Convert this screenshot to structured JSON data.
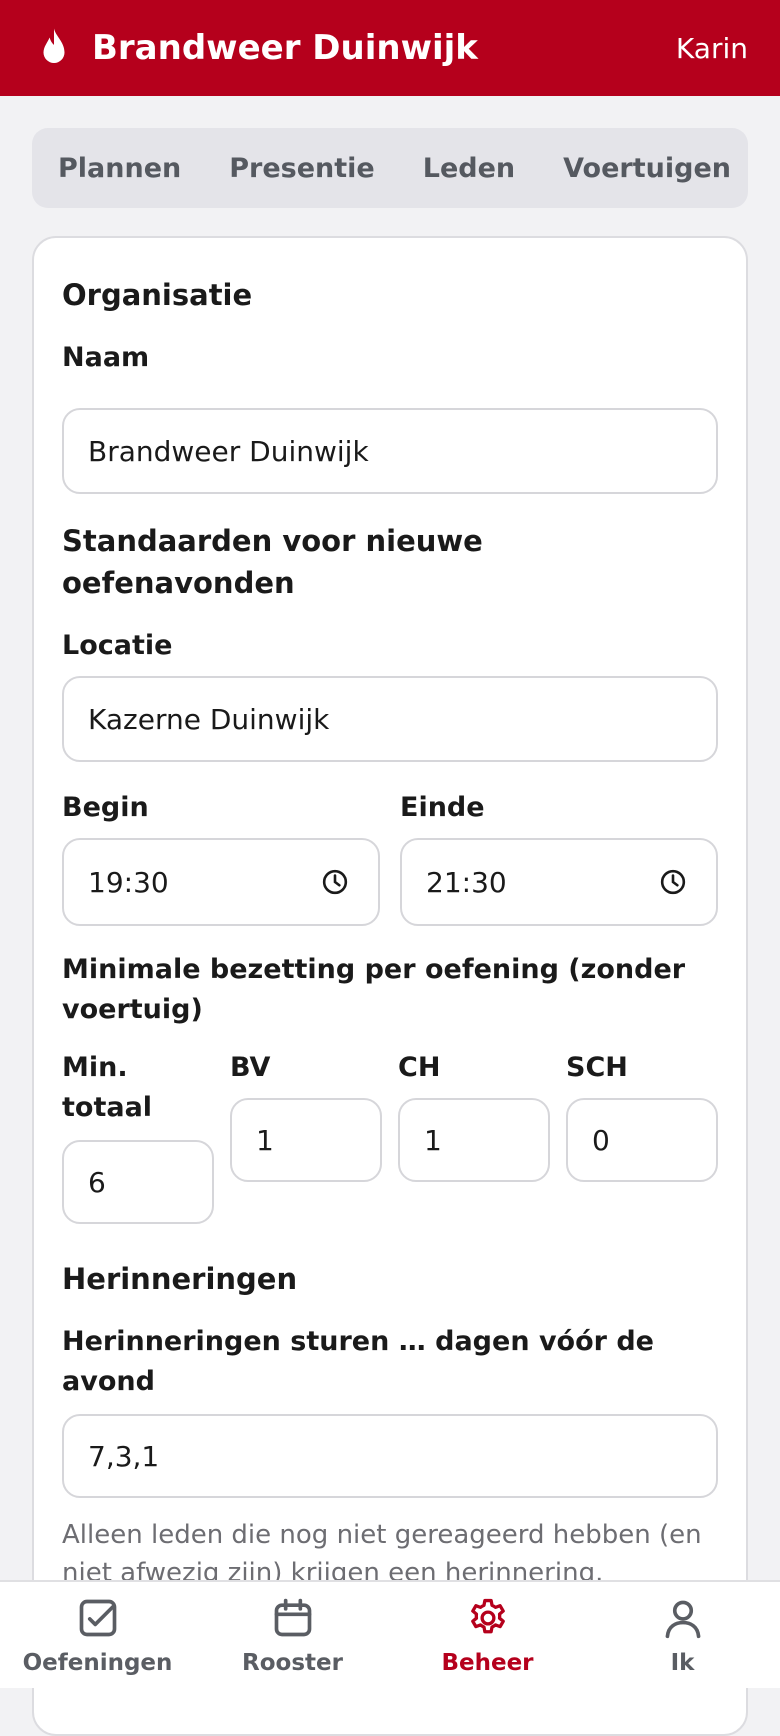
{
  "header": {
    "title": "Brandweer Duinwijk",
    "user": "Karin",
    "icon": "flame-icon"
  },
  "tabs": [
    {
      "label": "Plannen"
    },
    {
      "label": "Presentie"
    },
    {
      "label": "Leden"
    },
    {
      "label": "Voertuigen"
    }
  ],
  "form": {
    "section_org": "Organisatie",
    "naam_label": "Naam",
    "naam_value": "Brandweer Duinwijk",
    "section_defaults": "Standaarden voor nieuwe oefenavonden",
    "locatie_label": "Locatie",
    "locatie_value": "Kazerne Duinwijk",
    "begin_label": "Begin",
    "begin_value": "19:30",
    "einde_label": "Einde",
    "einde_value": "21:30",
    "bezetting_label": "Minimale bezetting per oefening (zonder voertuig)",
    "min_totaal_label": "Min. totaal",
    "min_totaal_value": "6",
    "bv_label": "BV",
    "bv_value": "1",
    "ch_label": "CH",
    "ch_value": "1",
    "sch_label": "SCH",
    "sch_value": "0",
    "section_reminders": "Herinneringen",
    "reminders_label": "Herinneringen sturen … dagen vóór de avond",
    "reminders_value": "7,3,1",
    "reminders_help": "Alleen leden die nog niet gereageerd hebben (en niet afwezig zijn) krijgen een herinnering."
  },
  "bottom_nav": [
    {
      "label": "Oefeningen",
      "icon": "checkbox-icon",
      "active": false
    },
    {
      "label": "Rooster",
      "icon": "calendar-icon",
      "active": false
    },
    {
      "label": "Beheer",
      "icon": "gear-icon",
      "active": true
    },
    {
      "label": "Ik",
      "icon": "person-icon",
      "active": false
    }
  ],
  "colors": {
    "brand": "#b5001c",
    "background": "#f2f2f4"
  }
}
